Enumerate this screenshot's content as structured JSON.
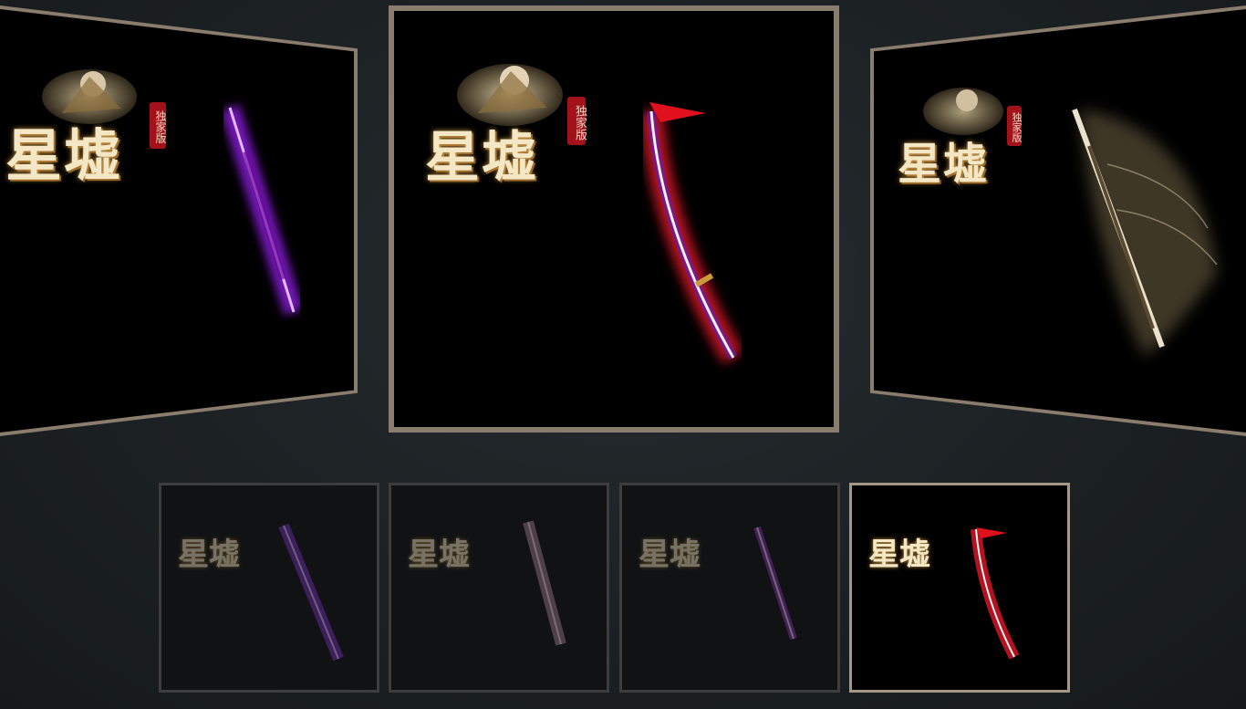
{
  "gallery": {
    "logo": {
      "title": "星墟",
      "seal": "独家版"
    },
    "main": {
      "weapon": "crimson-katana",
      "glow": "#ff1a2e"
    },
    "left": {
      "weapon": "violet-blade",
      "glow": "#a020ff"
    },
    "right": {
      "weapon": "golden-wind-blade",
      "glow": "#d9c39a"
    },
    "thumbnails": [
      {
        "weapon": "violet-greatsword",
        "glow": "#a23cff",
        "active": false
      },
      {
        "weapon": "pink-serrated-blade",
        "glow": "#d8a0b8",
        "active": false
      },
      {
        "weapon": "violet-slim-blade",
        "glow": "#b040e0",
        "active": false
      },
      {
        "weapon": "crimson-katana",
        "glow": "#ff1a2e",
        "active": true
      }
    ]
  }
}
